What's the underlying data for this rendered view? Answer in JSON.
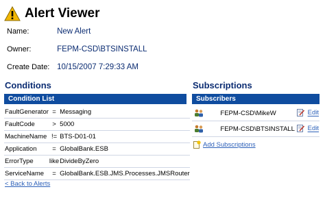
{
  "window": {
    "title": "Alert Viewer"
  },
  "details": {
    "name_label": "Name:",
    "name_value": "New Alert",
    "owner_label": "Owner:",
    "owner_value": "FEPM-CSD\\BTSINSTALL",
    "created_label": "Create Date:",
    "created_value": "10/15/2007 7:29:33 AM"
  },
  "conditions": {
    "section_title": "Conditions",
    "list_header": "Condition List",
    "rows": [
      {
        "name": "FaultGenerator",
        "op": "=",
        "value": "Messaging"
      },
      {
        "name": "FaultCode",
        "op": ">",
        "value": "5000"
      },
      {
        "name": "MachineName",
        "op": "!=",
        "value": "BTS-D01-01"
      },
      {
        "name": "Application",
        "op": "=",
        "value": "GlobalBank.ESB"
      },
      {
        "name": "ErrorType",
        "op": "like",
        "value": "DivideByZero"
      },
      {
        "name": "ServiceName",
        "op": "=",
        "value": "GlobalBank.ESB.JMS.Processes.JMSRouter"
      }
    ]
  },
  "subscriptions": {
    "section_title": "Subscriptions",
    "list_header": "Subscribers",
    "rows": [
      {
        "user": "FEPM-CSD\\MikeW",
        "edit_label": "Edit"
      },
      {
        "user": "FEPM-CSD\\BTSINSTALL",
        "edit_label": "Edit"
      }
    ],
    "add_label": "Add Subscriptions"
  },
  "nav": {
    "back_label": "< Back to Alerts"
  },
  "colors": {
    "header_bar": "#0f4c9f",
    "section_title": "#0b2c72",
    "link": "#2b5fb8",
    "warning": "#f2b705"
  },
  "icons": {
    "title": "warning-icon",
    "subscriber": "people-icon",
    "edit": "edit-icon",
    "add": "add-document-icon"
  }
}
